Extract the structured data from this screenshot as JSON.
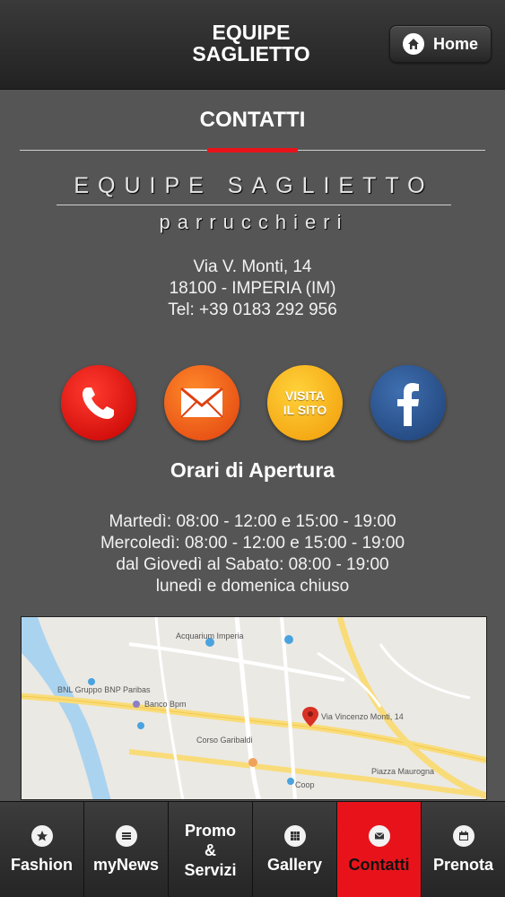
{
  "header": {
    "title": "EQUIPE\nSAGLIETTO",
    "home_label": "Home"
  },
  "page": {
    "title": "CONTATTI"
  },
  "logo": {
    "main": "EQUIPE SAGLIETTO",
    "sub": "parrucchieri"
  },
  "address": {
    "street": "Via V. Monti, 14",
    "city": "18100 - IMPERIA (IM)",
    "phone": "Tel: +39 0183 292 956"
  },
  "actions": {
    "phone_icon": "phone-icon",
    "mail_icon": "mail-icon",
    "website_label": "VISITA\nIL SITO",
    "facebook_icon": "facebook-icon"
  },
  "hours": {
    "title": "Orari di Apertura",
    "lines": [
      "Martedì: 08:00 - 12:00 e 15:00 - 19:00",
      "Mercoledì: 08:00 - 12:00 e 15:00 - 19:00",
      "dal Giovedì al Sabato: 08:00 - 19:00",
      "lunedì e domenica chiuso"
    ]
  },
  "map": {
    "labels": [
      "Acquarium Imperia",
      "BNL Gruppo BNP Paribas",
      "Banco Bpm",
      "Via Vincenzo Monti, 14",
      "Piazza Maurogna",
      "Coop",
      "Corso Garibaldi"
    ]
  },
  "tabs": [
    {
      "label": "Fashion",
      "icon": "star-icon"
    },
    {
      "label": "myNews",
      "icon": "list-icon"
    },
    {
      "label": "Promo\n&\nServizi",
      "icon": ""
    },
    {
      "label": "Gallery",
      "icon": "grid-icon"
    },
    {
      "label": "Contatti",
      "icon": "mail-icon",
      "active": true
    },
    {
      "label": "Prenota",
      "icon": "calendar-icon"
    }
  ],
  "colors": {
    "accent": "#e8131a",
    "background": "#555555",
    "facebook": "#2a5595"
  }
}
